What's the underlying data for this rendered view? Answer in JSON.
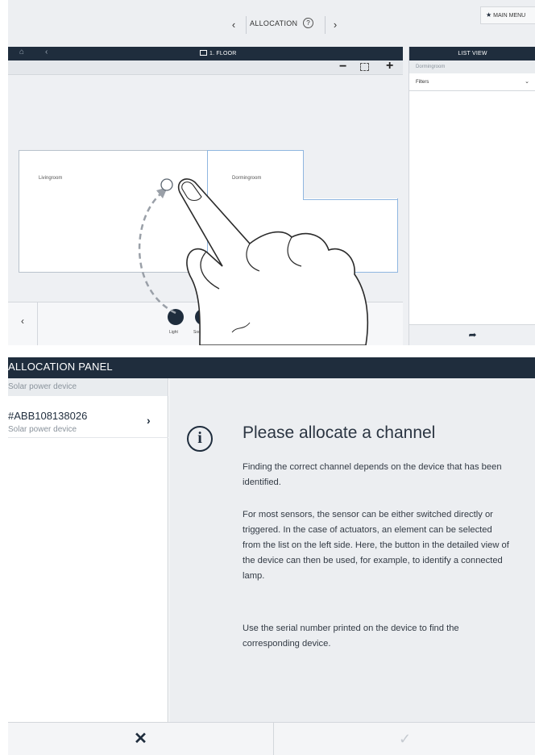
{
  "top": {
    "nav": {
      "prev": "‹",
      "title": "ALLOCATION",
      "help": "?",
      "next": "›"
    },
    "main_menu": {
      "icon": "★",
      "label": "MAIN MENU"
    },
    "floor": {
      "home_icon": "⌂",
      "back_icon": "‹",
      "title": "1. FLOOR",
      "zoom_out": "−",
      "zoom_in": "+",
      "rooms": [
        {
          "label": "Livingroom"
        },
        {
          "label": "Dormingroom"
        }
      ],
      "strip_prev": "‹",
      "devices": [
        {
          "label": "Light"
        },
        {
          "label": "Socket o"
        }
      ]
    },
    "list_view": {
      "title": "LIST VIEW",
      "subtitle": "Dormingroom",
      "filter": "Filters",
      "filter_chevron": "⌄",
      "back_icon": "➦"
    }
  },
  "bottom": {
    "title": "ALLOCATION PANEL",
    "subheader": "Solar power device",
    "item": {
      "id": "#ABB108138026",
      "type": "Solar power device",
      "chevron": "›"
    },
    "info_icon": "i",
    "heading": "Please allocate a channel",
    "paragraphs": [
      "Finding the correct channel depends on the device that has been identified.",
      "For most sensors, the sensor can be either switched directly or triggered. In the case of actuators, an element can be selected from the list on the left side. Here, the button in the detailed view of the device can then be used, for example, to identify a connected lamp.",
      "Use the serial number printed on the device to find the corresponding device."
    ],
    "cancel": "✕",
    "confirm": "✓"
  }
}
